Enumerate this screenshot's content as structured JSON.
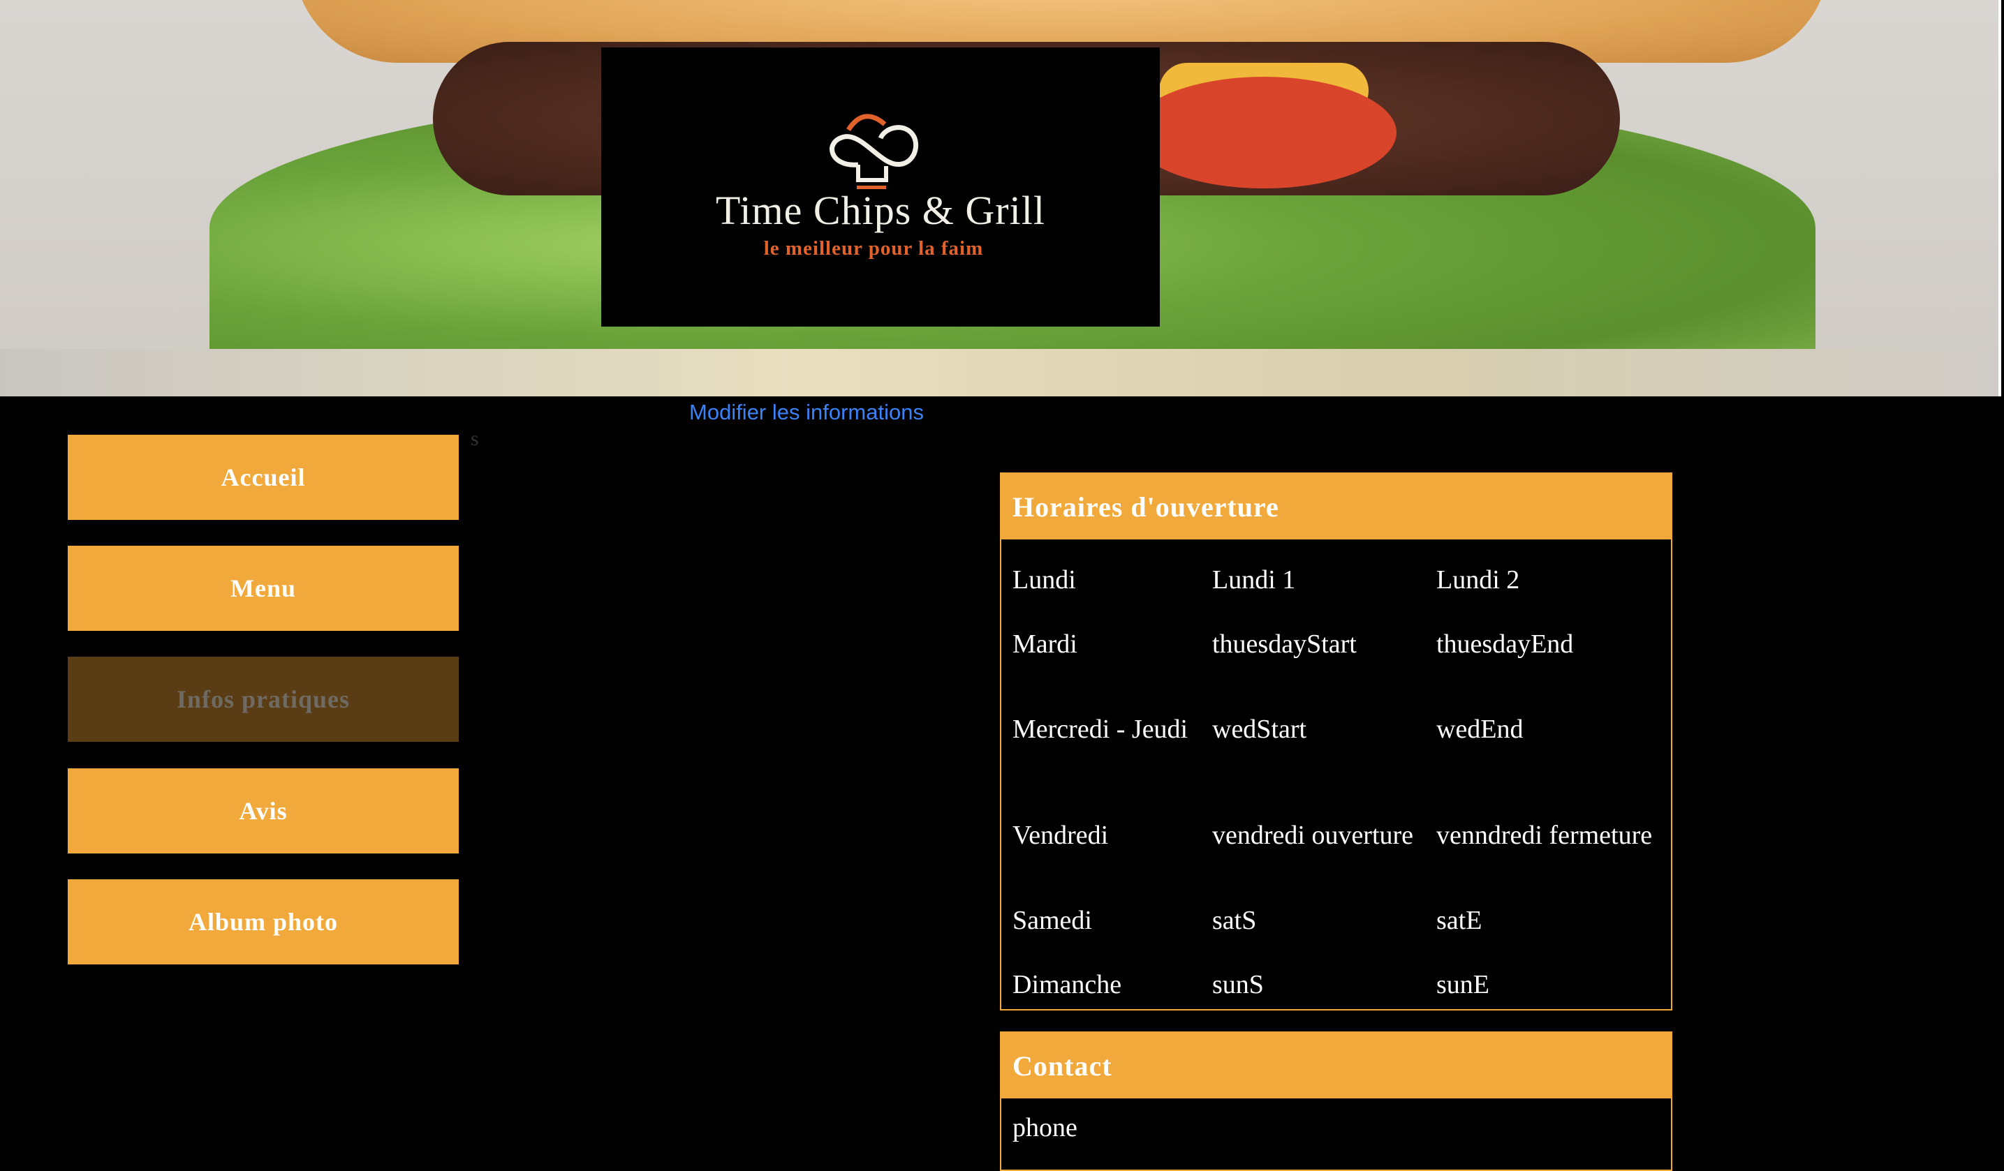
{
  "brand": {
    "name": "Time Chips & Grill",
    "tagline": "le meilleur pour la faim"
  },
  "edit_link": "Modifier les informations",
  "stray_text": "s",
  "nav": [
    {
      "label": "Accueil",
      "active": false
    },
    {
      "label": "Menu",
      "active": false
    },
    {
      "label": "Infos pratiques",
      "active": true
    },
    {
      "label": "Avis",
      "active": false
    },
    {
      "label": "Album photo",
      "active": false
    }
  ],
  "hours": {
    "title": "Horaires d'ouverture",
    "rows": [
      {
        "day": "Lundi",
        "start": "Lundi 1",
        "end": "Lundi 2"
      },
      {
        "day": "Mardi",
        "start": "thuesdayStart",
        "end": "thuesdayEnd"
      },
      {
        "day": "Mercredi - Jeudi",
        "start": "wedStart",
        "end": "wedEnd"
      },
      {
        "day": "Vendredi",
        "start": "vendredi ouverture",
        "end": "venndredi fermeture"
      },
      {
        "day": "Samedi",
        "start": "satS",
        "end": "satE"
      },
      {
        "day": "Dimanche",
        "start": "sunS",
        "end": "sunE"
      }
    ]
  },
  "contact": {
    "title": "Contact",
    "phone": "phone"
  },
  "colors": {
    "accent": "#f2a93b",
    "active_nav": "#5a3d15",
    "link": "#3b82f6",
    "logo_orange": "#e2622b"
  }
}
